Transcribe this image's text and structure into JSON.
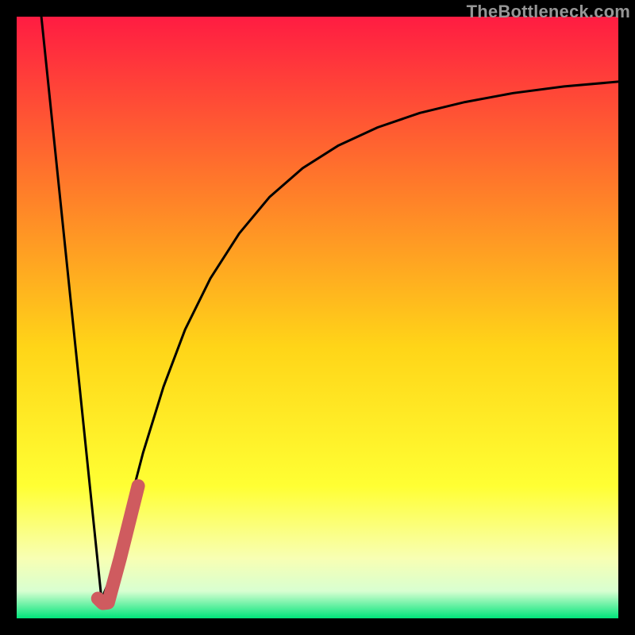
{
  "watermark": "TheBottleneck.com",
  "colors": {
    "frame": "#000000",
    "grad_top": "#ff1c42",
    "grad_mid1": "#ff7a2a",
    "grad_mid2": "#ffd518",
    "grad_mid3": "#ffff33",
    "grad_mid4": "#f8ffb3",
    "grad_bottom1": "#d8ffd1",
    "grad_bottom2": "#00e47a",
    "curve": "#000000",
    "accent": "#cf5b5f"
  },
  "chart_data": {
    "type": "line",
    "title": "",
    "xlabel": "",
    "ylabel": "",
    "xlim": [
      0,
      100
    ],
    "ylim": [
      0,
      100
    ],
    "series": [
      {
        "name": "curve-left",
        "x": [
          4.1,
          14.1
        ],
        "y": [
          100,
          3.2
        ]
      },
      {
        "name": "curve-right",
        "x": [
          14.1,
          15.7,
          18.0,
          21.0,
          24.4,
          28.0,
          32.2,
          37.0,
          42.0,
          47.5,
          53.5,
          60.0,
          67.0,
          74.5,
          82.5,
          91.0,
          100.0
        ],
        "y": [
          3.2,
          7.0,
          16.0,
          27.5,
          38.5,
          48.0,
          56.5,
          64.0,
          70.0,
          74.8,
          78.6,
          81.6,
          84.0,
          85.8,
          87.3,
          88.4,
          89.2
        ]
      },
      {
        "name": "accent-segment",
        "x": [
          13.5,
          14.3,
          15.2,
          17.2,
          19.2,
          20.2
        ],
        "y": [
          3.3,
          2.5,
          2.6,
          10.0,
          18.0,
          22.0
        ]
      }
    ],
    "grid": false,
    "legend": false
  }
}
